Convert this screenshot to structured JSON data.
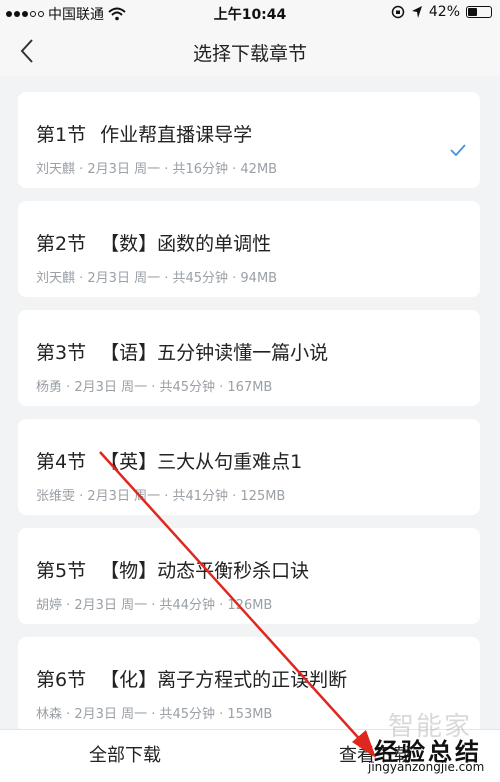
{
  "status_bar": {
    "carrier": "中国联通",
    "time": "上午10:44",
    "battery_text": "42%",
    "battery_level": 0.42
  },
  "nav": {
    "title": "选择下载章节",
    "back_icon": "chevron-left-icon"
  },
  "chapters": [
    {
      "num": "第1节",
      "title": "作业帮直播课导学",
      "meta": "刘天麒 · 2月3日 周一 · 共16分钟 · 42MB",
      "selected": true
    },
    {
      "num": "第2节",
      "title": "【数】函数的单调性",
      "meta": "刘天麒 · 2月3日 周一 · 共45分钟 · 94MB",
      "selected": false
    },
    {
      "num": "第3节",
      "title": "【语】五分钟读懂一篇小说",
      "meta": "杨勇 · 2月3日 周一 · 共45分钟 · 167MB",
      "selected": false
    },
    {
      "num": "第4节",
      "title": "【英】三大从句重难点1",
      "meta": "张维雯 · 2月3日 周一 · 共41分钟 · 125MB",
      "selected": false
    },
    {
      "num": "第5节",
      "title": "【物】动态平衡秒杀口诀",
      "meta": "胡婷 · 2月3日 周一 · 共44分钟 · 126MB",
      "selected": false
    },
    {
      "num": "第6节",
      "title": "【化】离子方程式的正误判断",
      "meta": "林森 · 2月3日 周一 · 共45分钟 · 153MB",
      "selected": false
    }
  ],
  "bottom": {
    "download_all": "全部下载",
    "view_downloads": "查看下载"
  },
  "watermark": {
    "logo": "智能家",
    "main": "经验总结",
    "url": "jingyanzongjie.com"
  },
  "colors": {
    "background": "#f2f3f5",
    "card": "#ffffff",
    "check": "#4a90e2",
    "annotation_arrow": "#e0271e"
  }
}
